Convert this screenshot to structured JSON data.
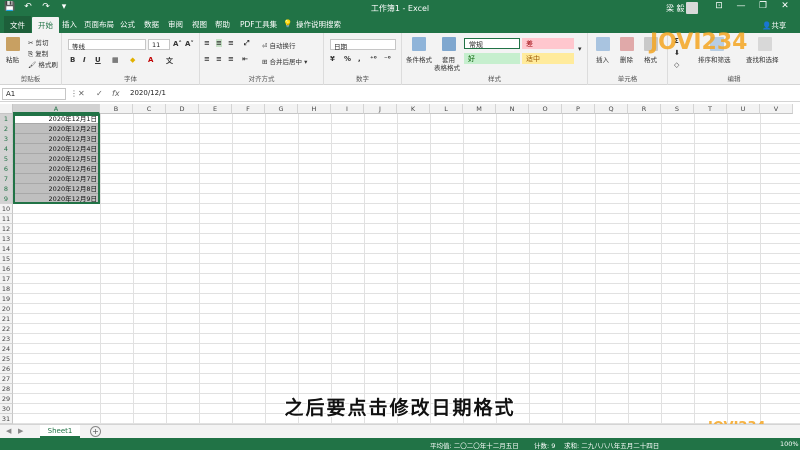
{
  "window": {
    "title": "工作簿1 - Excel",
    "user": "梁 毅",
    "minimize": "—",
    "restore": "❐",
    "close": "✕",
    "ribbon_toggle": "⊡"
  },
  "qat": {
    "save": "💾",
    "undo": "↶",
    "redo": "↷",
    "customize": "▾"
  },
  "tabs": {
    "file": "文件",
    "items": [
      "开始",
      "插入",
      "页面布局",
      "公式",
      "数据",
      "审阅",
      "视图",
      "帮助",
      "PDF工具集"
    ],
    "tell_me": "操作说明搜索",
    "share": "共享"
  },
  "ribbon": {
    "clipboard": {
      "paste": "粘贴",
      "cut": "剪切",
      "copy": "复制",
      "format_painter": "格式刷",
      "label": "剪贴板"
    },
    "font": {
      "name": "等线",
      "size": "11",
      "grow": "A˄",
      "shrink": "A˅",
      "bold": "B",
      "italic": "I",
      "underline": "U",
      "label": "字体"
    },
    "alignment": {
      "wrap": "自动换行",
      "merge": "合并后居中",
      "label": "对齐方式"
    },
    "number": {
      "format": "日期",
      "percent": "%",
      "comma": ",",
      "label": "数字"
    },
    "styles": {
      "conditional": "条件格式",
      "table": "套用",
      "table2": "表格格式",
      "normal": "常规",
      "bad": "差",
      "good": "好",
      "neutral": "适中",
      "label": "样式"
    },
    "cells": {
      "insert": "插入",
      "delete": "删除",
      "format": "格式",
      "label": "单元格"
    },
    "editing": {
      "sort": "排序和筛选",
      "find": "查找和选择",
      "label": "编辑"
    }
  },
  "formula_bar": {
    "name_box": "A1",
    "value": "2020/12/1",
    "cancel": "✕",
    "enter": "✓",
    "fx": "fx"
  },
  "columns": [
    "A",
    "B",
    "C",
    "D",
    "E",
    "F",
    "G",
    "H",
    "I",
    "J",
    "K",
    "L",
    "M",
    "N",
    "O",
    "P",
    "Q",
    "R",
    "S",
    "T",
    "U",
    "V"
  ],
  "rows": [
    "1",
    "2",
    "3",
    "4",
    "5",
    "6",
    "7",
    "8",
    "9",
    "10",
    "11",
    "12",
    "13",
    "14",
    "15",
    "16",
    "17",
    "18",
    "19",
    "20",
    "21",
    "22",
    "23",
    "24",
    "25",
    "26",
    "27",
    "28",
    "29",
    "30",
    "31",
    "32"
  ],
  "cells_a": [
    "2020年12月1日",
    "2020年12月2日",
    "2020年12月3日",
    "2020年12月4日",
    "2020年12月5日",
    "2020年12月6日",
    "2020年12月7日",
    "2020年12月8日",
    "2020年12月9日"
  ],
  "sheets": {
    "active": "Sheet1",
    "add": "+",
    "prev": "◀",
    "next": "▶"
  },
  "status": {
    "average": "平均值: 二〇二〇年十二月五日",
    "count": "计数: 9",
    "sum": "求和: 二九八八八年五月二十四日",
    "zoom": "100%"
  },
  "subtitle": "之后要点击修改日期格式",
  "watermark": "JOVI234",
  "colors": {
    "excel_green": "#217346",
    "selection": "#bfbfbf"
  }
}
